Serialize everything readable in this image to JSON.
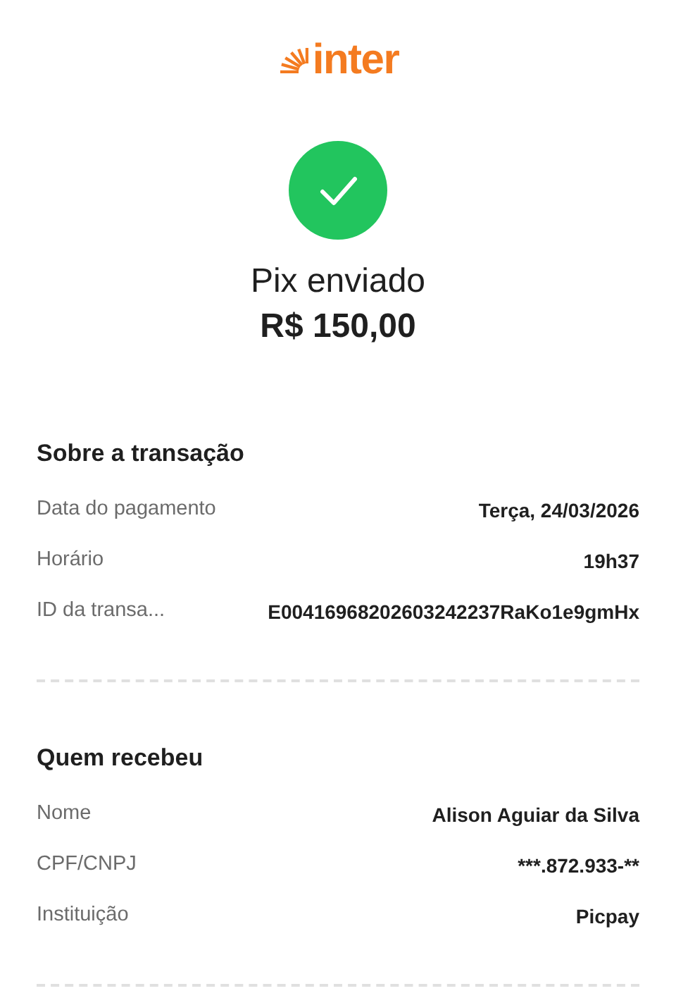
{
  "logo": {
    "text": "inter"
  },
  "status": {
    "title": "Pix enviado",
    "amount": "R$ 150,00"
  },
  "sections": [
    {
      "title": "Sobre a transação",
      "rows": [
        {
          "label": "Data do pagamento",
          "value": "Terça, 24/03/2026"
        },
        {
          "label": "Horário",
          "value": "19h37"
        },
        {
          "label": "ID da transa...",
          "value": "E00416968202603242237RaKo1e9gmHx"
        }
      ]
    },
    {
      "title": "Quem recebeu",
      "rows": [
        {
          "label": "Nome",
          "value": "Alison Aguiar da Silva"
        },
        {
          "label": "CPF/CNPJ",
          "value": "***.872.933-**"
        },
        {
          "label": "Instituição",
          "value": "Picpay"
        }
      ]
    }
  ]
}
